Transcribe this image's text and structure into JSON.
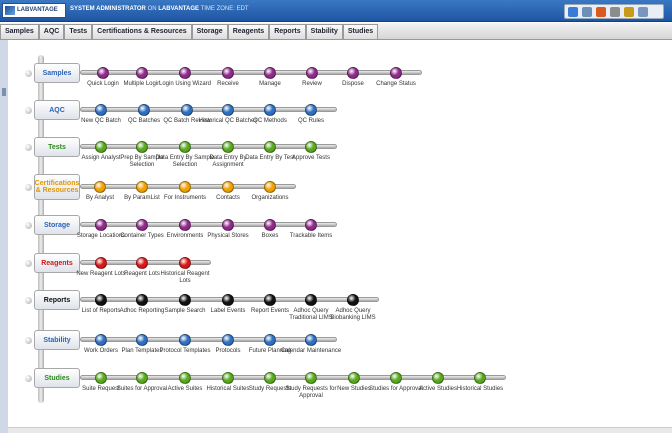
{
  "header": {
    "logo_text": "LABVANTAGE",
    "user": "SYSTEM ADMINISTRATOR",
    "on_text": "ON",
    "server": "LABVANTAGE",
    "tz_text": "TIME ZONE: EDT",
    "tools": [
      "help-icon",
      "filter-icon",
      "forward-icon",
      "mail-icon",
      "user-icon",
      "window-icon"
    ]
  },
  "nav": {
    "tabs": [
      "Samples",
      "AQC",
      "Tests",
      "Certifications & Resources",
      "Storage",
      "Reagents",
      "Reports",
      "Stability",
      "Studies"
    ]
  },
  "colors": {
    "purple": "#8e2a8a",
    "blue": "#2f6fbf",
    "green": "#58a81e",
    "orange": "#f0a000",
    "red": "#d81818",
    "black": "#111111"
  },
  "modules": [
    {
      "label": "Samples",
      "label_color": "#2a63b8",
      "color": "purple",
      "items": [
        "Quick Login",
        "Multiple Login",
        "Login Using Wizard",
        "Receive",
        "Manage",
        "Review",
        "Dispose",
        "Change Status"
      ]
    },
    {
      "label": "AQC",
      "label_color": "#2a63b8",
      "color": "blue",
      "items": [
        "New QC Batch",
        "QC Batches",
        "QC Batch Review",
        "Historical QC Batches",
        "QC Methods",
        "QC Rules"
      ]
    },
    {
      "label": "Tests",
      "label_color": "#2e8a1e",
      "color": "green",
      "items": [
        "Assign Analyst",
        "Prep By Sample Selection",
        "Data Entry By Sample Selection",
        "Data Entry By Assignment",
        "Data Entry By Test",
        "Approve Tests"
      ]
    },
    {
      "label": "Certifications & Resources",
      "label_color": "#e39500",
      "color": "orange",
      "items": [
        "By Analyst",
        "By ParamList",
        "For Instruments",
        "Contacts",
        "Organizations"
      ]
    },
    {
      "label": "Storage",
      "label_color": "#2a63b8",
      "color": "purple",
      "items": [
        "Storage Locations",
        "Container Types",
        "Environments",
        "Physical Stores",
        "Boxes",
        "Trackable Items"
      ]
    },
    {
      "label": "Reagents",
      "label_color": "#d01818",
      "color": "red",
      "items": [
        "New Reagent Lots",
        "Reagent Lots",
        "Historical Reagent Lots"
      ]
    },
    {
      "label": "Reports",
      "label_color": "#111111",
      "color": "black",
      "items": [
        "List of Reports",
        "Adhoc Reporting",
        "Sample Search",
        "Label Events",
        "Report Events",
        "Adhoc Query Traditional LIMS",
        "Adhoc Query Biobanking LIMS"
      ]
    },
    {
      "label": "Stability",
      "label_color": "#2a63b8",
      "color": "blue",
      "items": [
        "Work Orders",
        "Plan Templates",
        "Protocol Templates",
        "Protocols",
        "Future Planning",
        "Calendar Maintenance"
      ]
    },
    {
      "label": "Studies",
      "label_color": "#2e8a1e",
      "color": "green",
      "items": [
        "Suite Request",
        "Suites for Approval",
        "Active Suites",
        "Historical Suites",
        "Study Requests",
        "Study Requests for Approval",
        "New Studies",
        "Studies for Approval",
        "Active Studies",
        "Historical Studies"
      ]
    }
  ]
}
